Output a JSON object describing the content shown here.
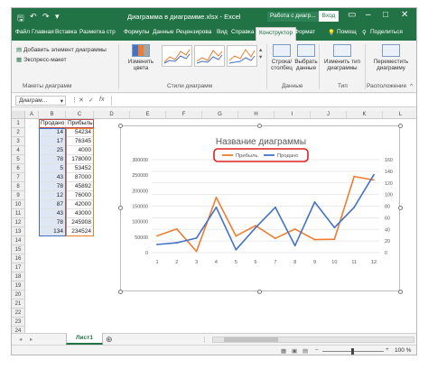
{
  "titlebar": {
    "title": "Диаграмма в диаграмме.xlsx  -  Excel",
    "context_label": "Работа с диагр...",
    "signin": "Вход"
  },
  "tabs": [
    "Файл",
    "Главная",
    "Вставка",
    "Разметка стр",
    "Формулы",
    "Данные",
    "Рецензирова",
    "Вид",
    "Справка",
    "Конструктор",
    "Формат",
    "Помощ",
    "Поделиться"
  ],
  "ribbon": {
    "add_element": "Добавить элемент диаграммы",
    "express_layout": "Экспресс-макет",
    "layouts_group": "Макеты диаграмм",
    "change_colors": "Изменить цвета",
    "styles_group": "Стили диаграмм",
    "row_col": "Строка/ столбец",
    "select_data": "Выбрать данные",
    "data_group": "Данные",
    "change_type": "Изменить тип диаграммы",
    "type_group": "Тип",
    "move_chart": "Переместить диаграмму",
    "location_group": "Расположение"
  },
  "formulabar": {
    "namebox": "Диаграм...",
    "fx": "fx"
  },
  "columns": [
    "A",
    "B",
    "C",
    "D",
    "E",
    "F",
    "G",
    "H",
    "I",
    "J",
    "K",
    "L",
    "M"
  ],
  "rows": [
    "1",
    "2",
    "3",
    "4",
    "5",
    "6",
    "7",
    "8",
    "9",
    "10",
    "11",
    "12",
    "13",
    "14",
    "15",
    "16",
    "17",
    "18",
    "19",
    "20",
    "21",
    "22",
    "23",
    "24"
  ],
  "table": {
    "headers": [
      "Продано",
      "Прибыль"
    ],
    "data": [
      [
        "14",
        "54234"
      ],
      [
        "17",
        "76345"
      ],
      [
        "25",
        "4000"
      ],
      [
        "78",
        "178000"
      ],
      [
        "5",
        "53452"
      ],
      [
        "43",
        "87000"
      ],
      [
        "78",
        "45892"
      ],
      [
        "12",
        "76000"
      ],
      [
        "87",
        "42000"
      ],
      [
        "43",
        "43000"
      ],
      [
        "78",
        "245908"
      ],
      [
        "134",
        "234524"
      ]
    ]
  },
  "chart_data": {
    "type": "line",
    "title": "Название диаграммы",
    "categories": [
      "1",
      "2",
      "3",
      "4",
      "5",
      "6",
      "7",
      "8",
      "9",
      "10",
      "11",
      "12"
    ],
    "y_left": {
      "range": [
        0,
        300000
      ],
      "ticks": [
        "0",
        "50000",
        "100000",
        "150000",
        "200000",
        "250000",
        "300000"
      ]
    },
    "y_right": {
      "range": [
        0,
        160
      ],
      "ticks": [
        "0",
        "20",
        "40",
        "60",
        "80",
        "100",
        "120",
        "140",
        "160"
      ]
    },
    "series": [
      {
        "name": "Прибыль",
        "axis": "left",
        "color": "#ED7D31",
        "values": [
          54234,
          76345,
          4000,
          178000,
          53452,
          87000,
          45892,
          76000,
          42000,
          43000,
          245908,
          234524
        ]
      },
      {
        "name": "Продано",
        "axis": "right",
        "color": "#4472C4",
        "values": [
          14,
          17,
          25,
          78,
          5,
          43,
          78,
          12,
          87,
          43,
          78,
          134
        ]
      }
    ],
    "legend_position": "top",
    "legend_highlight_color": "#E02020",
    "grid": true
  },
  "sheet_tab": "Лист1",
  "statusbar": {
    "zoom": "100 %"
  },
  "colors": {
    "excel_green": "#217346",
    "selection": "#dfe7f4"
  }
}
